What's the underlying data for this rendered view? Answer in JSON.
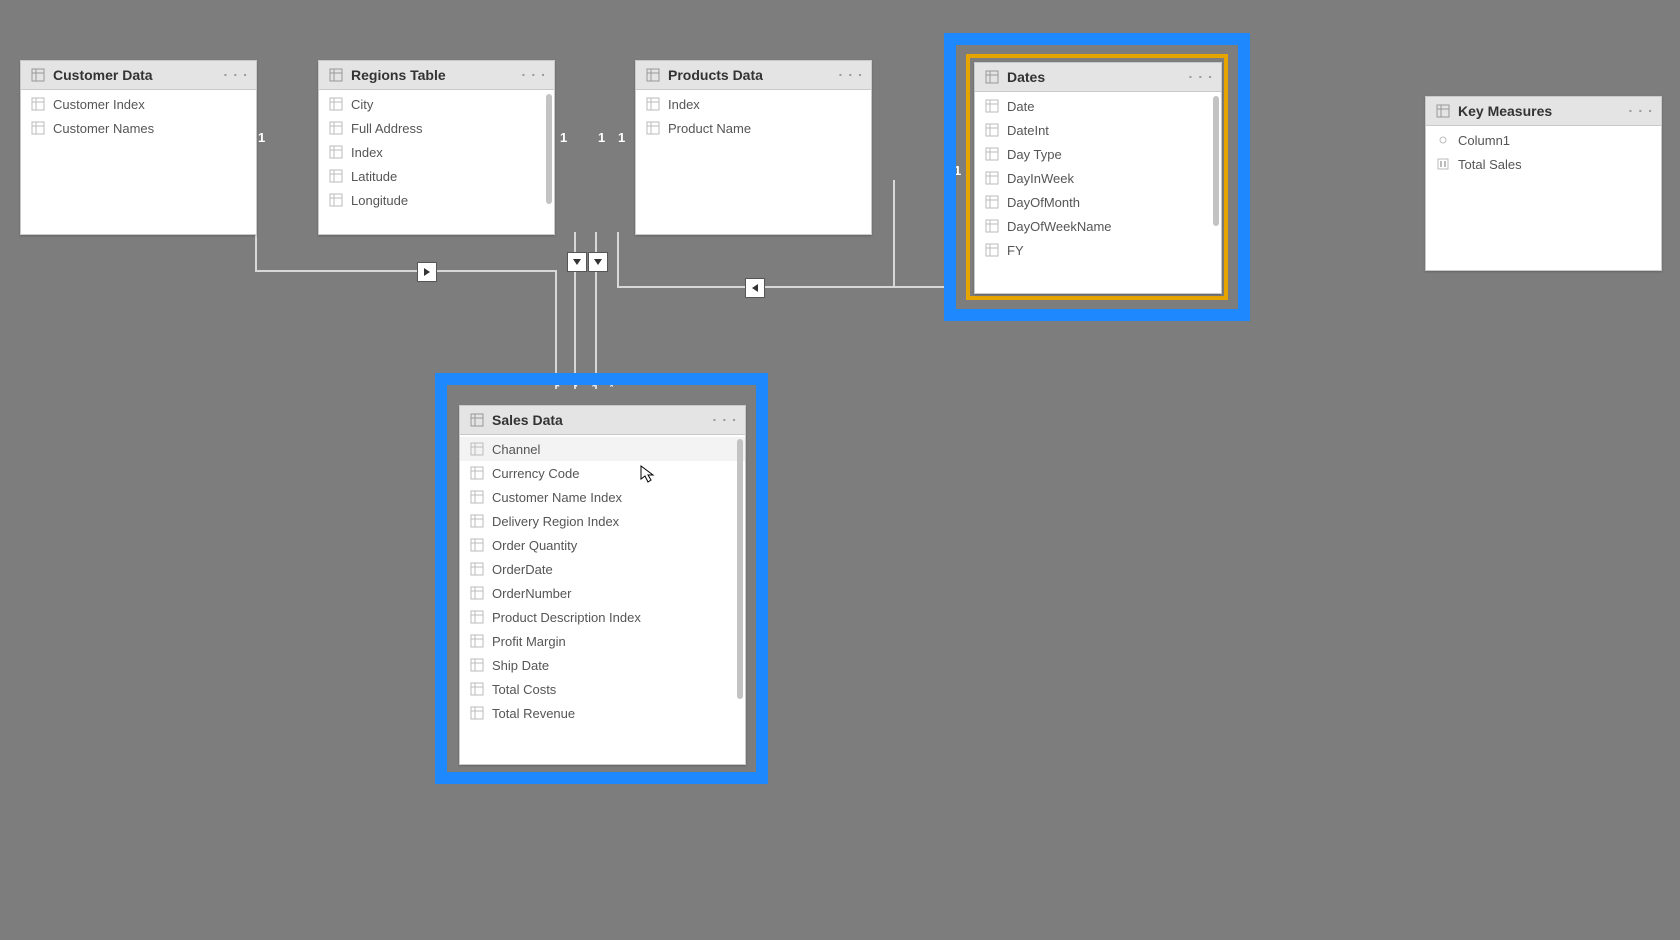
{
  "tables": {
    "customer": {
      "title": "Customer Data",
      "columns": [
        "Customer Index",
        "Customer Names"
      ]
    },
    "regions": {
      "title": "Regions Table",
      "columns": [
        "City",
        "Full Address",
        "Index",
        "Latitude",
        "Longitude"
      ]
    },
    "products": {
      "title": "Products Data",
      "columns": [
        "Index",
        "Product Name"
      ]
    },
    "dates": {
      "title": "Dates",
      "columns": [
        "Date",
        "DateInt",
        "Day Type",
        "DayInWeek",
        "DayOfMonth",
        "DayOfWeekName",
        "FY"
      ]
    },
    "keymeasures": {
      "title": "Key Measures",
      "columns": [
        {
          "label": "Column1",
          "icon": "link"
        },
        {
          "label": "Total Sales",
          "icon": "measure"
        }
      ]
    },
    "sales": {
      "title": "Sales Data",
      "columns": [
        "Channel",
        "Currency Code",
        "Customer Name Index",
        "Delivery Region Index",
        "Order Quantity",
        "OrderDate",
        "OrderNumber",
        "Product Description Index",
        "Profit Margin",
        "Ship Date",
        "Total Costs",
        "Total Revenue"
      ]
    }
  },
  "highlight": {
    "salesColor": "#1e88ff",
    "datesOuter": "#1e88ff",
    "datesInner": "#e5a400"
  },
  "cardinality": {
    "one": "1"
  }
}
